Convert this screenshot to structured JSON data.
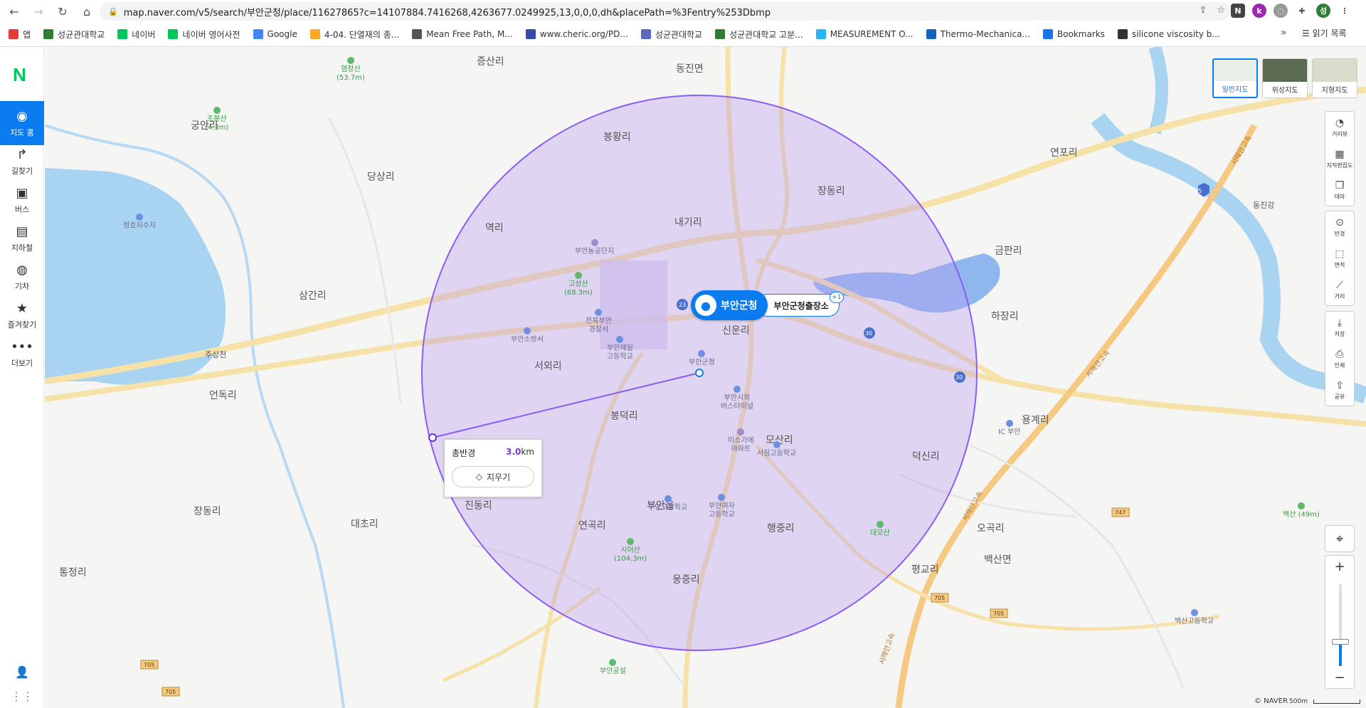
{
  "browser": {
    "url": "map.naver.com/v5/search/부안군청/place/11627865?c=14107884.7416268,4263677.0249925,13,0,0,0,dh&placePath=%3Fentry%253Dbmp",
    "bookmarks": [
      {
        "label": "앱",
        "color": "#e53935"
      },
      {
        "label": "성균관대학교",
        "color": "#2e7d32"
      },
      {
        "label": "네이버",
        "color": "#03c75a"
      },
      {
        "label": "네이버 영어사전",
        "color": "#03c75a"
      },
      {
        "label": "Google",
        "color": "#4285f4"
      },
      {
        "label": "4-04. 단열재의 종...",
        "color": "#f9a825"
      },
      {
        "label": "Mean Free Path, M...",
        "color": "#555555"
      },
      {
        "label": "www.cheric.org/PD...",
        "color": "#3949ab"
      },
      {
        "label": "성균관대학교",
        "color": "#5c6bc0"
      },
      {
        "label": "성균관대학교 고분...",
        "color": "#2e7d32"
      },
      {
        "label": "MEASUREMENT O...",
        "color": "#29b6f6"
      },
      {
        "label": "Thermo-Mechanica...",
        "color": "#1565c0"
      },
      {
        "label": "Bookmarks",
        "color": "#1a73e8"
      },
      {
        "label": "silicone viscosity b...",
        "color": "#333333"
      }
    ],
    "more": "»",
    "reading_list": "읽기 목록"
  },
  "leftnav": {
    "logo": "N",
    "items": [
      {
        "label": "지도 홈",
        "icon": "map-pin-icon",
        "glyph": "◉",
        "active": true
      },
      {
        "label": "길찾기",
        "icon": "directions-icon",
        "glyph": "↱",
        "active": false
      },
      {
        "label": "버스",
        "icon": "bus-icon",
        "glyph": "▣",
        "active": false
      },
      {
        "label": "지하철",
        "icon": "subway-icon",
        "glyph": "▤",
        "active": false
      },
      {
        "label": "기차",
        "icon": "train-icon",
        "glyph": "◍",
        "active": false
      },
      {
        "label": "즐겨찾기",
        "icon": "star-icon",
        "glyph": "★",
        "active": false
      },
      {
        "label": "더보기",
        "icon": "more-icon",
        "glyph": "•••",
        "active": false
      }
    ]
  },
  "map": {
    "places": [
      {
        "label": "증산리"
      },
      {
        "label": "동진면"
      },
      {
        "label": "궁안리"
      },
      {
        "label": "봉황리"
      },
      {
        "label": "당상리"
      },
      {
        "label": "장동리"
      },
      {
        "label": "연포리"
      },
      {
        "label": "내기리"
      },
      {
        "label": "역리"
      },
      {
        "label": "금판리"
      },
      {
        "label": "삼간리"
      },
      {
        "label": "하장리"
      },
      {
        "label": "신운리"
      },
      {
        "label": "서외리"
      },
      {
        "label": "언독리"
      },
      {
        "label": "봉덕리"
      },
      {
        "label": "용계리"
      },
      {
        "label": "모산리"
      },
      {
        "label": "덕신리"
      },
      {
        "label": "진동리"
      },
      {
        "label": "부안읍"
      },
      {
        "label": "장동리"
      },
      {
        "label": "대초리"
      },
      {
        "label": "연곡리"
      },
      {
        "label": "행중리"
      },
      {
        "label": "오곡리"
      },
      {
        "label": "통정리"
      },
      {
        "label": "웅중리"
      },
      {
        "label": "평교리"
      },
      {
        "label": "백산면"
      },
      {
        "label": "주상천"
      },
      {
        "label": "동진강"
      }
    ],
    "pois": [
      {
        "label": "염장산\n(53.7m)",
        "kind": "green"
      },
      {
        "label": "조봉산\n(4.3m)",
        "kind": "green"
      },
      {
        "label": "청호저수지",
        "kind": "blue"
      },
      {
        "label": "부안농공단지",
        "kind": "purple"
      },
      {
        "label": "고성산\n(68.3m)",
        "kind": "green"
      },
      {
        "label": "전북부안\n경찰서",
        "kind": "blue"
      },
      {
        "label": "부안소방서",
        "kind": "blue"
      },
      {
        "label": "부안제일\n고등학교",
        "kind": "blue"
      },
      {
        "label": "부안군청",
        "kind": "blue"
      },
      {
        "label": "부안시외\n버스터미널",
        "kind": "blue"
      },
      {
        "label": "미소가에\n아파트",
        "kind": "purple"
      },
      {
        "label": "서림고등학교",
        "kind": "blue"
      },
      {
        "label": "부안고등학교",
        "kind": "blue"
      },
      {
        "label": "부안여자\n고등학교",
        "kind": "blue"
      },
      {
        "label": "시어산\n(104.3m)",
        "kind": "green"
      },
      {
        "label": "대모산",
        "kind": "green"
      },
      {
        "label": "백산 (49m)",
        "kind": "green"
      },
      {
        "label": "백산고등학교",
        "kind": "blue"
      },
      {
        "label": "부안공설",
        "kind": "green"
      },
      {
        "label": "IC 부안",
        "kind": "blue"
      }
    ],
    "road_labels": [
      "23",
      "30",
      "30",
      "15",
      "747",
      "705",
      "705",
      "705",
      "705"
    ],
    "highway_labels": [
      "서해안고속",
      "서해안고속",
      "서해안고속",
      "서해안고속"
    ],
    "marker": {
      "title": "부안군청",
      "sub": "부안군청출장소",
      "badge": "+1"
    },
    "radius": {
      "label": "총반경",
      "value": "3.0",
      "unit": "km",
      "erase": "지우기"
    },
    "credit": "© NAVER",
    "scale": "500m"
  },
  "map_types": [
    {
      "label": "일반지도",
      "selected": true
    },
    {
      "label": "위성지도",
      "selected": false
    },
    {
      "label": "지형지도",
      "selected": false
    }
  ],
  "tools_top": [
    {
      "label": "거리뷰",
      "icon": "streetview-icon",
      "glyph": "◔"
    },
    {
      "label": "지적편집도",
      "icon": "cadastral-icon",
      "glyph": "▦"
    },
    {
      "label": "테마",
      "icon": "theme-icon",
      "glyph": "❐"
    }
  ],
  "tools_mid": [
    {
      "label": "반경",
      "icon": "radius-icon",
      "glyph": "⊙"
    },
    {
      "label": "면적",
      "icon": "area-icon",
      "glyph": "⬚"
    },
    {
      "label": "거리",
      "icon": "ruler-icon",
      "glyph": "⟋"
    }
  ],
  "tools_bot": [
    {
      "label": "저장",
      "icon": "save-icon",
      "glyph": "⤓"
    },
    {
      "label": "인쇄",
      "icon": "print-icon",
      "glyph": "⎙"
    },
    {
      "label": "공유",
      "icon": "share-icon",
      "glyph": "⇪"
    }
  ],
  "zoom": {
    "plus": "+",
    "minus": "−",
    "level": 0.3
  }
}
